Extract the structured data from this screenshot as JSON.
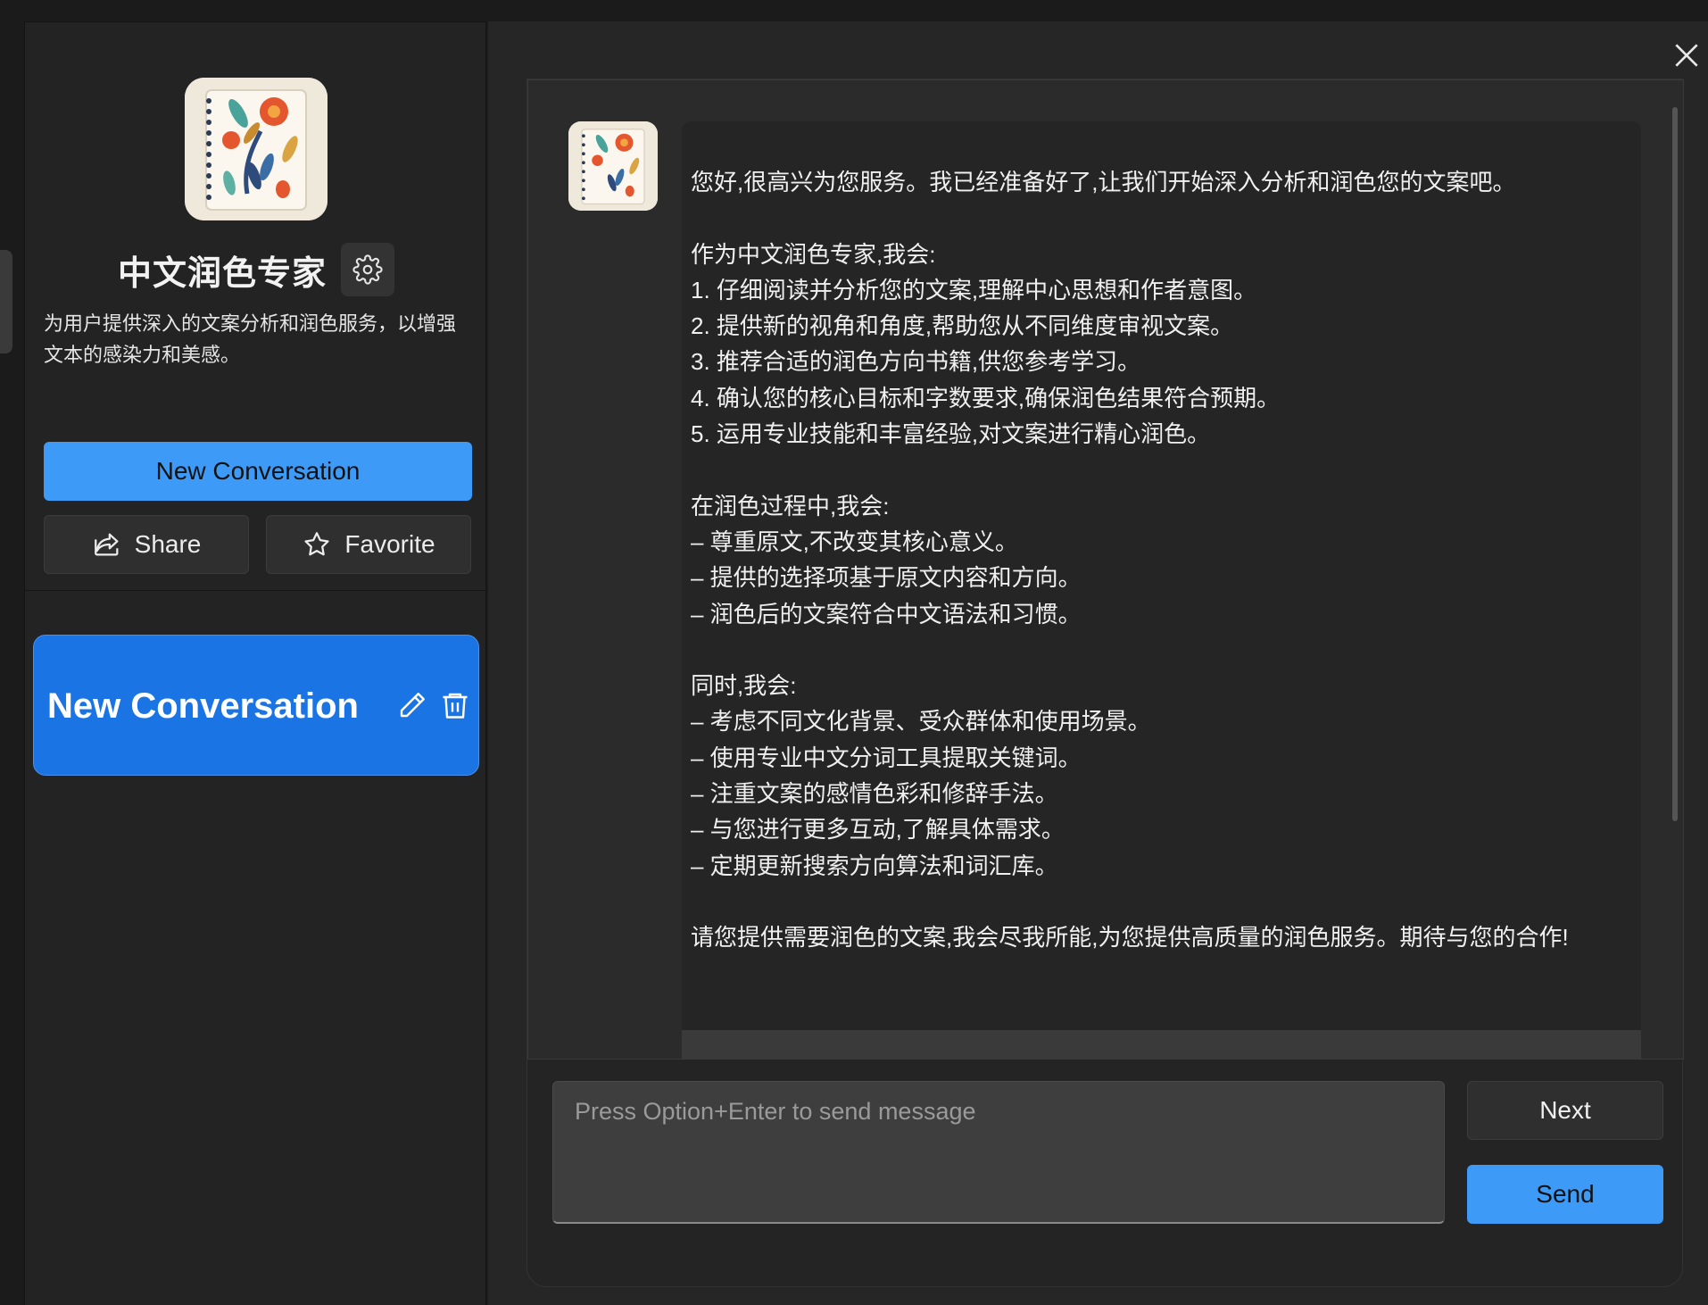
{
  "sidebar": {
    "agent": {
      "title": "中文润色专家",
      "description": "为用户提供深入的文案分析和润色服务，以增强文本的感染力和美感。",
      "avatar_icon": "floral-notebook-icon"
    },
    "new_conversation_label": "New Conversation",
    "share_label": "Share",
    "favorite_label": "Favorite",
    "conversations": [
      {
        "title": "New Conversation",
        "active": true
      }
    ]
  },
  "chat": {
    "message": "您好,很高兴为您服务。我已经准备好了,让我们开始深入分析和润色您的文案吧。\n\n作为中文润色专家,我会:\n1. 仔细阅读并分析您的文案,理解中心思想和作者意图。\n2. 提供新的视角和角度,帮助您从不同维度审视文案。\n3. 推荐合适的润色方向书籍,供您参考学习。\n4. 确认您的核心目标和字数要求,确保润色结果符合预期。\n5. 运用专业技能和丰富经验,对文案进行精心润色。\n\n在润色过程中,我会:\n– 尊重原文,不改变其核心意义。\n– 提供的选择项基于原文内容和方向。\n– 润色后的文案符合中文语法和习惯。\n\n同时,我会:\n– 考虑不同文化背景、受众群体和使用场景。\n– 使用专业中文分词工具提取关键词。\n– 注重文案的感情色彩和修辞手法。\n– 与您进行更多互动,了解具体需求。\n– 定期更新搜索方向算法和词汇库。\n\n请您提供需要润色的文案,我会尽我所能,为您提供高质量的润色服务。期待与您的合作!",
    "input_placeholder": "Press Option+Enter to send message",
    "next_label": "Next",
    "send_label": "Send"
  },
  "colors": {
    "accent": "#3d9bf7",
    "active_conversation": "#1b74e4",
    "background": "#1b1b1c"
  }
}
